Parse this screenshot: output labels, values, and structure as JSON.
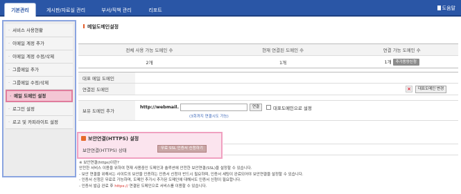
{
  "topnav": {
    "tabs": [
      "기본관리",
      "게시판/자료실 관리",
      "부서/직책 관리",
      "리포트"
    ],
    "help": "도움말"
  },
  "sidebar": {
    "items": [
      "서비스 사용현황",
      "이메일 계정 추가",
      "이메일 계정 수정/삭제",
      "그룹메일 추가",
      "그룹메일 수정/삭제",
      "메일 도메인 설정",
      "로그인 설정",
      "로고 및 카피라이트 설정"
    ],
    "selected": "메일 도메인 설정"
  },
  "section": {
    "title": "메일도메인설정"
  },
  "stats": {
    "headers": [
      "전체 사용 가능 도메인 수",
      "현재 연결된 도메인 수",
      "연결 가능 도메인 수"
    ],
    "values": [
      "2개",
      "1개",
      "1개"
    ],
    "add_button": "추가용량신청"
  },
  "form": {
    "representative_label": "대표 메일 도메인",
    "connected_label": "연결된 도메인",
    "connected_button": "대표도메인 변경",
    "remove_icon": "x-icon",
    "owned_label": "보유 도메인 추가",
    "url_prefix": "http://webmail.",
    "connect_button": "연결",
    "checkbox_label": "대표도메인으로 설정",
    "attempts_note": "(3회까지 연결시도 가능)"
  },
  "https": {
    "title": "보안연결(HTTPS) 설정",
    "status_label": "보안연결(HTTPS) 상태",
    "request_button": "무료 SSL 인증서 신청하기"
  },
  "notes": {
    "heading": "※ 보안연결(https)이란?",
    "lines": [
      "안전한 서비스 이용을 위하여 현재 사용중인 도메인과 솔루션에 안전한 보안연결(SSL)을 설정할 수 있습니다.",
      "- 보안 연결을 위해서는 사이트의 보안을 인증하는 인증서 신청이 반드시 필요하며, 인증서 세팅이 완료되어야 보안연결을 설정할 수 있습니다.",
      "- 인증서 신청은 무료로 가능하며, 도메인 추가시 추가된 도메인에 대해서도 인증서 신청이 필요합니다."
    ],
    "last_prefix": "- 인증서 발급 완료 후 ",
    "last_highlight": "https://",
    "last_suffix": " 연결된 도메인으로 서비스를 이용할 수 있습니다."
  },
  "colors": {
    "nav": "#2a56a6",
    "highlight_border": "#e07c9c",
    "sidebar_border": "#8aa4e0",
    "accent": "#e35d2a"
  }
}
